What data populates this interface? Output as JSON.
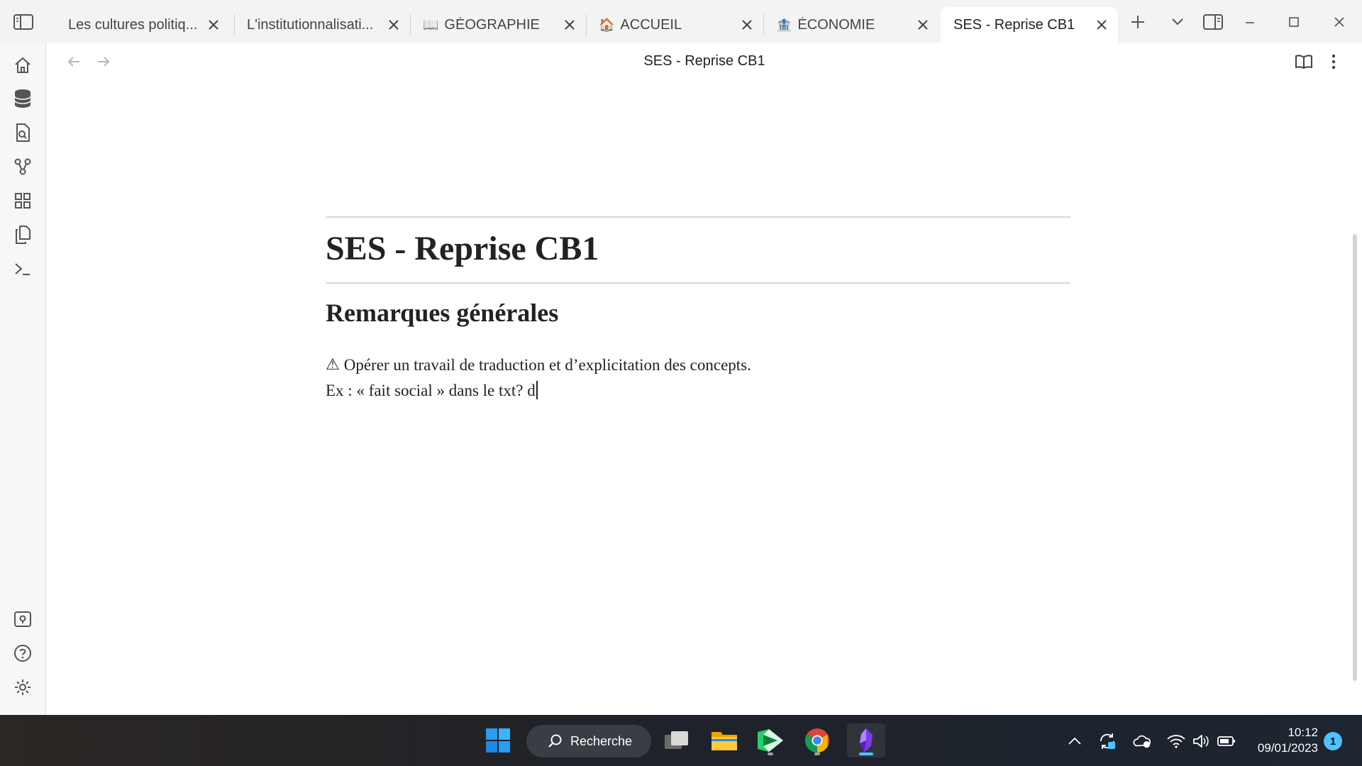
{
  "tabs": [
    {
      "label": "Les cultures politiq...",
      "emoji": "",
      "active": false
    },
    {
      "label": "L'institutionnalisati...",
      "emoji": "",
      "active": false
    },
    {
      "label": "GÉOGRAPHIE",
      "emoji": "📖",
      "active": false
    },
    {
      "label": "ACCUEIL",
      "emoji": "🏠",
      "active": false
    },
    {
      "label": "ÉCONOMIE",
      "emoji": "🏦",
      "active": false
    },
    {
      "label": "SES - Reprise CB1",
      "emoji": "",
      "active": true
    }
  ],
  "tabbar_icons": {
    "sidebar_toggle": "sidebar-toggle-icon",
    "new_tab": "plus-icon",
    "tab_list": "chevron-down-icon",
    "split_view": "split-view-icon",
    "minimize": "minimize-icon",
    "maximize": "maximize-icon",
    "close": "close-icon"
  },
  "ribbon": {
    "top": [
      "home-icon",
      "database-icon",
      "file-search-icon",
      "graph-icon",
      "layout-grid-icon",
      "copy-files-icon",
      "terminal-icon"
    ],
    "bottom": [
      "vault-icon",
      "help-icon",
      "settings-icon"
    ]
  },
  "view": {
    "title": "SES - Reprise CB1",
    "actions": [
      "reading-view-icon",
      "more-options-icon"
    ]
  },
  "document": {
    "h1": "SES - Reprise CB1",
    "h2": "Remarques générales",
    "warning_symbol": "⚠",
    "line1": "Opérer un travail de traduction et d’explicitation des concepts.",
    "line2": "Ex : « fait social » dans le txt? d"
  },
  "taskbar": {
    "search_label": "Recherche",
    "apps": [
      "windows-start-icon",
      "task-view-icon",
      "file-explorer-icon",
      "app-green-icon",
      "chrome-icon",
      "obsidian-icon"
    ],
    "tray": [
      "chevron-up-icon",
      "sync-icon",
      "onedrive-icon",
      "wifi-icon",
      "volume-icon",
      "battery-icon"
    ],
    "time": "10:12",
    "date": "09/01/2023",
    "notification_count": "1"
  },
  "colors": {
    "accent": "#4cc2ff",
    "obsidian": "#7c3aed",
    "taskbar": "#202020"
  }
}
